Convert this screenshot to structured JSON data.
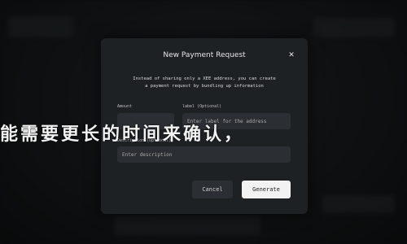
{
  "overlay_text": "能需要更长的时间来确认，",
  "modal": {
    "title": "New Payment Request",
    "close_icon": "close-icon",
    "description_line1": "Instead of sharing only a XEE address, you can create",
    "description_line2": "a payment request by bundling up information",
    "amount": {
      "label": "Amount",
      "value": "",
      "placeholder": ""
    },
    "label_field": {
      "label": "label (Optional)",
      "value": "",
      "placeholder": "Enter label for the address"
    },
    "description_field": {
      "label": "Description (Optional)",
      "value": "",
      "placeholder": "Enter description"
    },
    "cancel_label": "Cancel",
    "generate_label": "Generate"
  }
}
